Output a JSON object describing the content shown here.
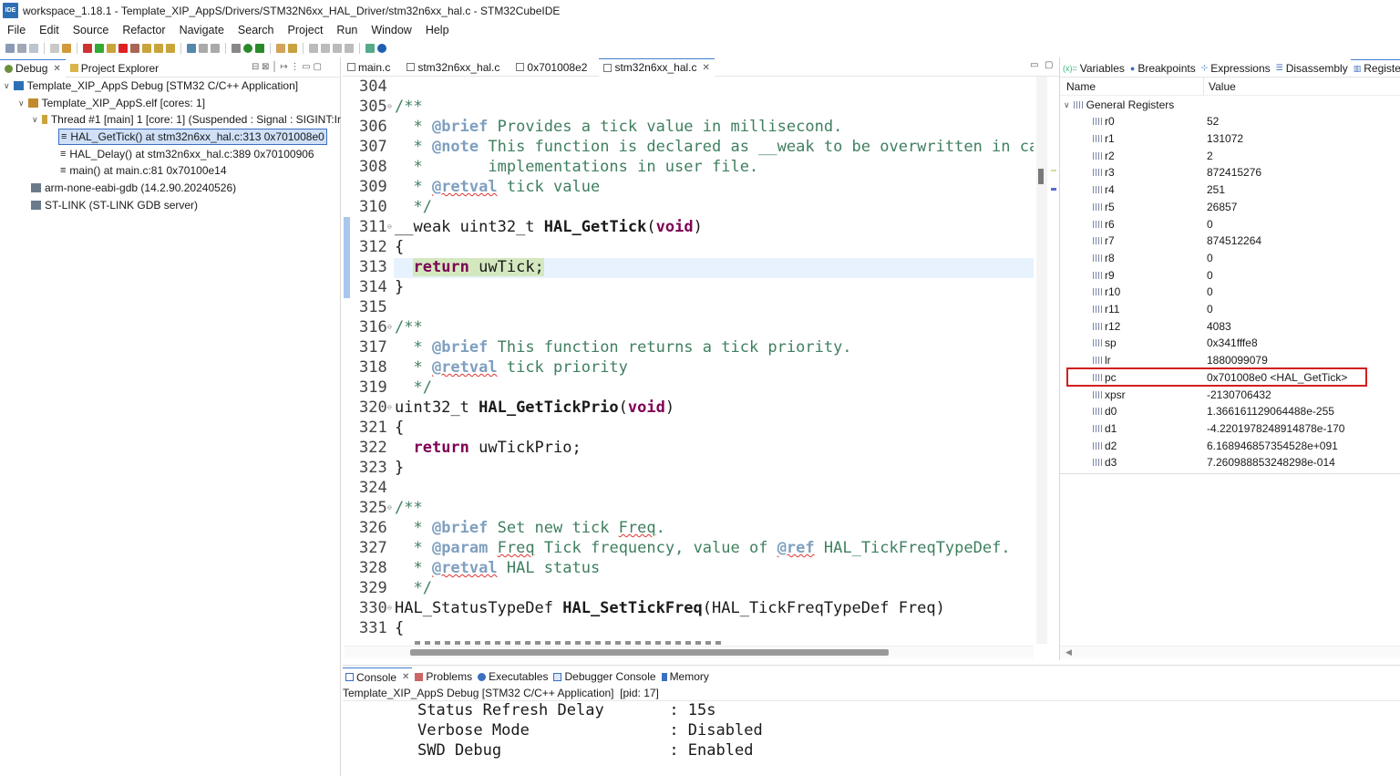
{
  "window": {
    "title": "workspace_1.18.1 - Template_XIP_AppS/Drivers/STM32N6xx_HAL_Driver/stm32n6xx_hal.c - STM32CubeIDE",
    "logo_text": "IDE"
  },
  "menu": [
    "File",
    "Edit",
    "Source",
    "Refactor",
    "Navigate",
    "Search",
    "Project",
    "Run",
    "Window",
    "Help"
  ],
  "debug_view": {
    "tabs": [
      {
        "label": "Debug"
      },
      {
        "label": "Project Explorer"
      }
    ],
    "tree": [
      {
        "label": "Template_XIP_AppS Debug [STM32 C/C++ Application]"
      },
      {
        "label": "Template_XIP_AppS.elf [cores: 1]"
      },
      {
        "label": "Thread #1 [main] 1 [core: 1] (Suspended : Signal : SIGINT:Ir"
      },
      {
        "label": "HAL_GetTick() at stm32n6xx_hal.c:313 0x701008e0"
      },
      {
        "label": "HAL_Delay() at stm32n6xx_hal.c:389 0x70100906"
      },
      {
        "label": "main() at main.c:81 0x70100e14"
      },
      {
        "label": "arm-none-eabi-gdb (14.2.90.20240526)"
      },
      {
        "label": "ST-LINK (ST-LINK GDB server)"
      }
    ]
  },
  "editor": {
    "tabs": [
      {
        "label": "main.c"
      },
      {
        "label": "stm32n6xx_hal.c"
      },
      {
        "label": "0x701008e2"
      },
      {
        "label": "stm32n6xx_hal.c"
      }
    ],
    "lines": [
      {
        "n": "304",
        "html": ""
      },
      {
        "n": "305",
        "html": "<span class='cm'>/**</span>"
      },
      {
        "n": "306",
        "html": "<span class='cm'>  * <span class='tag'>@brief</span> Provides a tick value in millisecond.</span>"
      },
      {
        "n": "307",
        "html": "<span class='cm'>  * <span class='tag'>@note</span> This function is declared as __weak to be overwritten in case of other</span>"
      },
      {
        "n": "308",
        "html": "<span class='cm'>  *       implementations in user file.</span>"
      },
      {
        "n": "309",
        "html": "<span class='cm'>  * <span class='tag squig'>@retval</span> tick value</span>"
      },
      {
        "n": "310",
        "html": "<span class='cm'>  */</span>"
      },
      {
        "n": "311",
        "html": "__weak <span class='kw' style='font-weight:normal;color:#1a1a1a'>uint32_t</span> <span class='fn'>HAL_GetTick</span>(<span class='kw'>void</span>)"
      },
      {
        "n": "312",
        "html": "{"
      },
      {
        "n": "313",
        "html": "  <span style='background:#d4e8c0'><span class='kw'>return</span> uwTick;</span>"
      },
      {
        "n": "314",
        "html": "}"
      },
      {
        "n": "315",
        "html": ""
      },
      {
        "n": "316",
        "html": "<span class='cm'>/**</span>"
      },
      {
        "n": "317",
        "html": "<span class='cm'>  * <span class='tag'>@brief</span> This function returns a tick priority.</span>"
      },
      {
        "n": "318",
        "html": "<span class='cm'>  * <span class='tag squig'>@retval</span> tick priority</span>"
      },
      {
        "n": "319",
        "html": "<span class='cm'>  */</span>"
      },
      {
        "n": "320",
        "html": "uint32_t <span class='fn'>HAL_GetTickPrio</span>(<span class='kw'>void</span>)"
      },
      {
        "n": "321",
        "html": "{"
      },
      {
        "n": "322",
        "html": "  <span class='kw'>return</span> uwTickPrio;"
      },
      {
        "n": "323",
        "html": "}"
      },
      {
        "n": "324",
        "html": ""
      },
      {
        "n": "325",
        "html": "<span class='cm'>/**</span>"
      },
      {
        "n": "326",
        "html": "<span class='cm'>  * <span class='tag'>@brief</span> Set new tick <span class='squig'>Freq</span>.</span>"
      },
      {
        "n": "327",
        "html": "<span class='cm'>  * <span class='tag'>@param</span> <span class='squig'>Freq</span> Tick frequency, value of <span class='tag squig'>@ref</span> HAL_TickFreqTypeDef.</span>"
      },
      {
        "n": "328",
        "html": "<span class='cm'>  * <span class='tag squig'>@retval</span> HAL status</span>"
      },
      {
        "n": "329",
        "html": "<span class='cm'>  */</span>"
      },
      {
        "n": "330",
        "html": "HAL_StatusTypeDef <span class='fn'>HAL_SetTickFreq</span>(HAL_TickFreqTypeDef Freq)"
      },
      {
        "n": "331",
        "html": "{"
      }
    ]
  },
  "registers_view": {
    "tabs": [
      {
        "label": "Variables"
      },
      {
        "label": "Breakpoints"
      },
      {
        "label": "Expressions"
      },
      {
        "label": "Disassembly"
      },
      {
        "label": "Registers"
      }
    ],
    "col_name": "Name",
    "col_value": "Value",
    "group": "General Registers",
    "rows": [
      {
        "name": "r0",
        "value": "52"
      },
      {
        "name": "r1",
        "value": "131072"
      },
      {
        "name": "r2",
        "value": "2"
      },
      {
        "name": "r3",
        "value": "872415276"
      },
      {
        "name": "r4",
        "value": "251"
      },
      {
        "name": "r5",
        "value": "26857"
      },
      {
        "name": "r6",
        "value": "0"
      },
      {
        "name": "r7",
        "value": "874512264"
      },
      {
        "name": "r8",
        "value": "0"
      },
      {
        "name": "r9",
        "value": "0"
      },
      {
        "name": "r10",
        "value": "0"
      },
      {
        "name": "r11",
        "value": "0"
      },
      {
        "name": "r12",
        "value": "4083"
      },
      {
        "name": "sp",
        "value": "0x341fffe8"
      },
      {
        "name": "lr",
        "value": "1880099079"
      },
      {
        "name": "pc",
        "value": "0x701008e0 <HAL_GetTick>"
      },
      {
        "name": "xpsr",
        "value": "-2130706432"
      },
      {
        "name": "d0",
        "value": "1.366161129064488e-255"
      },
      {
        "name": "d1",
        "value": "-4.2201978248914878e-170"
      },
      {
        "name": "d2",
        "value": "6.168946857354528e+091"
      },
      {
        "name": "d3",
        "value": "7.260988853248298e-014"
      }
    ]
  },
  "console": {
    "tabs": [
      {
        "label": "Console"
      },
      {
        "label": "Problems"
      },
      {
        "label": "Executables"
      },
      {
        "label": "Debugger Console"
      },
      {
        "label": "Memory"
      }
    ],
    "process": "Template_XIP_AppS Debug [STM32 C/C++ Application]  [pid: 17]",
    "lines": [
      "Status Refresh Delay       : 15s",
      "Verbose Mode               : Disabled",
      "SWD Debug                  : Enabled"
    ]
  }
}
